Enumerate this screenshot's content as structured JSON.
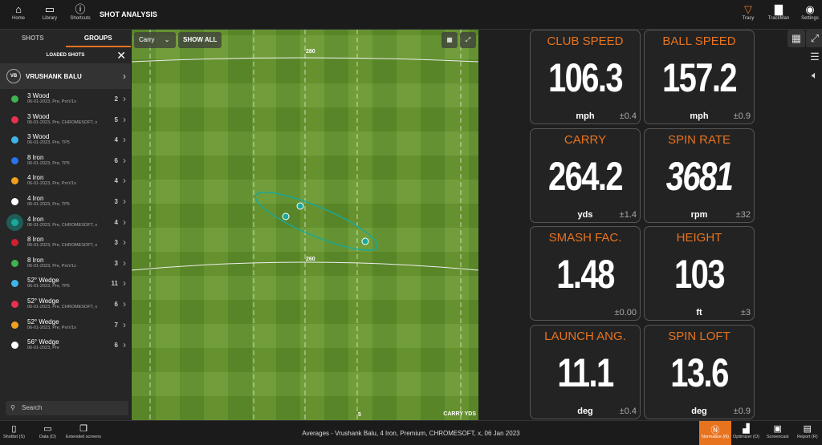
{
  "topbar": {
    "home": "Home",
    "library": "Library",
    "shortcuts": "Shortcuts",
    "title": "SHOT ANALYSIS",
    "tracy": "Tracy",
    "trackman": "TrackMan",
    "settings": "Settings"
  },
  "sidebar": {
    "tabs": [
      "SHOTS",
      "GROUPS"
    ],
    "active_tab": "GROUPS",
    "loaded_shots": "LOADED SHOTS",
    "player": {
      "initials": "VB",
      "name": "VRUSHANK BALU"
    },
    "groups": [
      {
        "name": "3 Wood",
        "sub": "06-01-2023, Pre, ProV1x",
        "count": "2",
        "color": "#3fb34f"
      },
      {
        "name": "3 Wood",
        "sub": "06-01-2023, Pre, CHROMESOFT, x",
        "count": "5",
        "color": "#e8304f"
      },
      {
        "name": "3 Wood",
        "sub": "06-01-2023, Pre, TP5",
        "count": "4",
        "color": "#3fb4e8"
      },
      {
        "name": "8 Iron",
        "sub": "06-01-2023, Pre, TP5",
        "count": "6",
        "color": "#2a72e8"
      },
      {
        "name": "4 Iron",
        "sub": "06-01-2023, Pre, ProV1x",
        "count": "4",
        "color": "#f0a020"
      },
      {
        "name": "4 Iron",
        "sub": "06-01-2023, Pre, TP5",
        "count": "3",
        "color": "#ffffff"
      },
      {
        "name": "4 Iron",
        "sub": "06-01-2023, Pre, CHROMESOFT, x",
        "count": "4",
        "color": "#1aa898",
        "selected": true
      },
      {
        "name": "8 Iron",
        "sub": "06-01-2023, Pre, CHROMESOFT, x",
        "count": "3",
        "color": "#d0202f"
      },
      {
        "name": "8 Iron",
        "sub": "06-01-2023, Pre, ProV1x",
        "count": "3",
        "color": "#3fb34f"
      },
      {
        "name": "52° Wedge",
        "sub": "06-01-2023, Pre, TP5",
        "count": "11",
        "color": "#3fb4e8"
      },
      {
        "name": "52° Wedge",
        "sub": "06-01-2023, Pre, CHROMESOFT, x",
        "count": "6",
        "color": "#e8304f"
      },
      {
        "name": "52° Wedge",
        "sub": "06-01-2023, Pre, ProV1x",
        "count": "7",
        "color": "#f0a020"
      },
      {
        "name": "56° Wedge",
        "sub": "06-01-2023, Pre",
        "count": "6",
        "color": "#ffffff"
      }
    ],
    "search_placeholder": "Search"
  },
  "field": {
    "dropdown": "Carry",
    "show_all": "SHOW ALL",
    "labels": {
      "y280": "280",
      "y260": "260",
      "bottom": "5",
      "unit": "CARRY YDS"
    }
  },
  "tiles": [
    {
      "label": "CLUB SPEED",
      "value": "106.3",
      "unit": "mph",
      "dev": "±0.4"
    },
    {
      "label": "BALL SPEED",
      "value": "157.2",
      "unit": "mph",
      "dev": "±0.9"
    },
    {
      "label": "CARRY",
      "value": "264.2",
      "unit": "yds",
      "dev": "±1.4"
    },
    {
      "label": "SPIN RATE",
      "value": "3681",
      "unit": "rpm",
      "dev": "±32",
      "italic": true
    },
    {
      "label": "SMASH FAC.",
      "value": "1.48",
      "unit": "",
      "dev": "±0.00"
    },
    {
      "label": "HEIGHT",
      "value": "103",
      "unit": "ft",
      "dev": "±3"
    },
    {
      "label": "LAUNCH ANG.",
      "value": "11.1",
      "unit": "deg",
      "dev": "±0.4"
    },
    {
      "label": "SPIN LOFT",
      "value": "13.6",
      "unit": "deg",
      "dev": "±0.9"
    }
  ],
  "bottombar": {
    "shotlist": "Shotlist (S)",
    "data": "Data (D)",
    "extended": "Extended screens",
    "averages": "Averages - Vrushank Balu, 4 Iron, Premium, CHROMESOFT, x, 06 Jan 2023",
    "normalize": "Normalize (N)",
    "optimizer": "Optimizer (O)",
    "screencast": "Screencast",
    "report": "Report (R)"
  },
  "colors": {
    "accent": "#e8731f",
    "dispersion": "#1aa898"
  }
}
